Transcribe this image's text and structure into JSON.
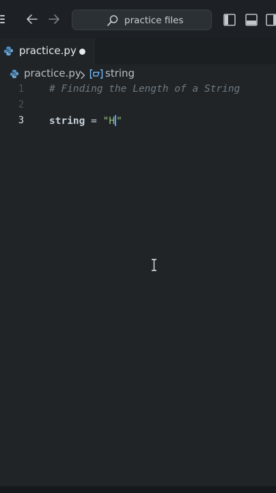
{
  "titlebar": {
    "search_text": "practice files",
    "icons": [
      "menu-icon",
      "back-arrow-icon",
      "forward-arrow-icon",
      "search-icon",
      "toggle-sidebar-icon",
      "toggle-panel-icon",
      "toggle-secondary-sidebar-icon"
    ]
  },
  "tabs": [
    {
      "label": "practice.py",
      "modified": true,
      "active": true
    }
  ],
  "breadcrumb": {
    "file": "practice.py",
    "symbol": "string"
  },
  "editor": {
    "language": "python",
    "lines": [
      {
        "number": "1",
        "text": "# Finding the Length of a String"
      },
      {
        "number": "2",
        "text": ""
      },
      {
        "number": "3",
        "var": "string",
        "op": " = ",
        "str": "\"H",
        "str_end": "\""
      }
    ],
    "active_line": "3"
  },
  "colors": {
    "background": "#202427",
    "titlebar": "#1d2125",
    "comment": "#6f7a82",
    "string": "#98c379",
    "caret": "#5aa0ff"
  }
}
